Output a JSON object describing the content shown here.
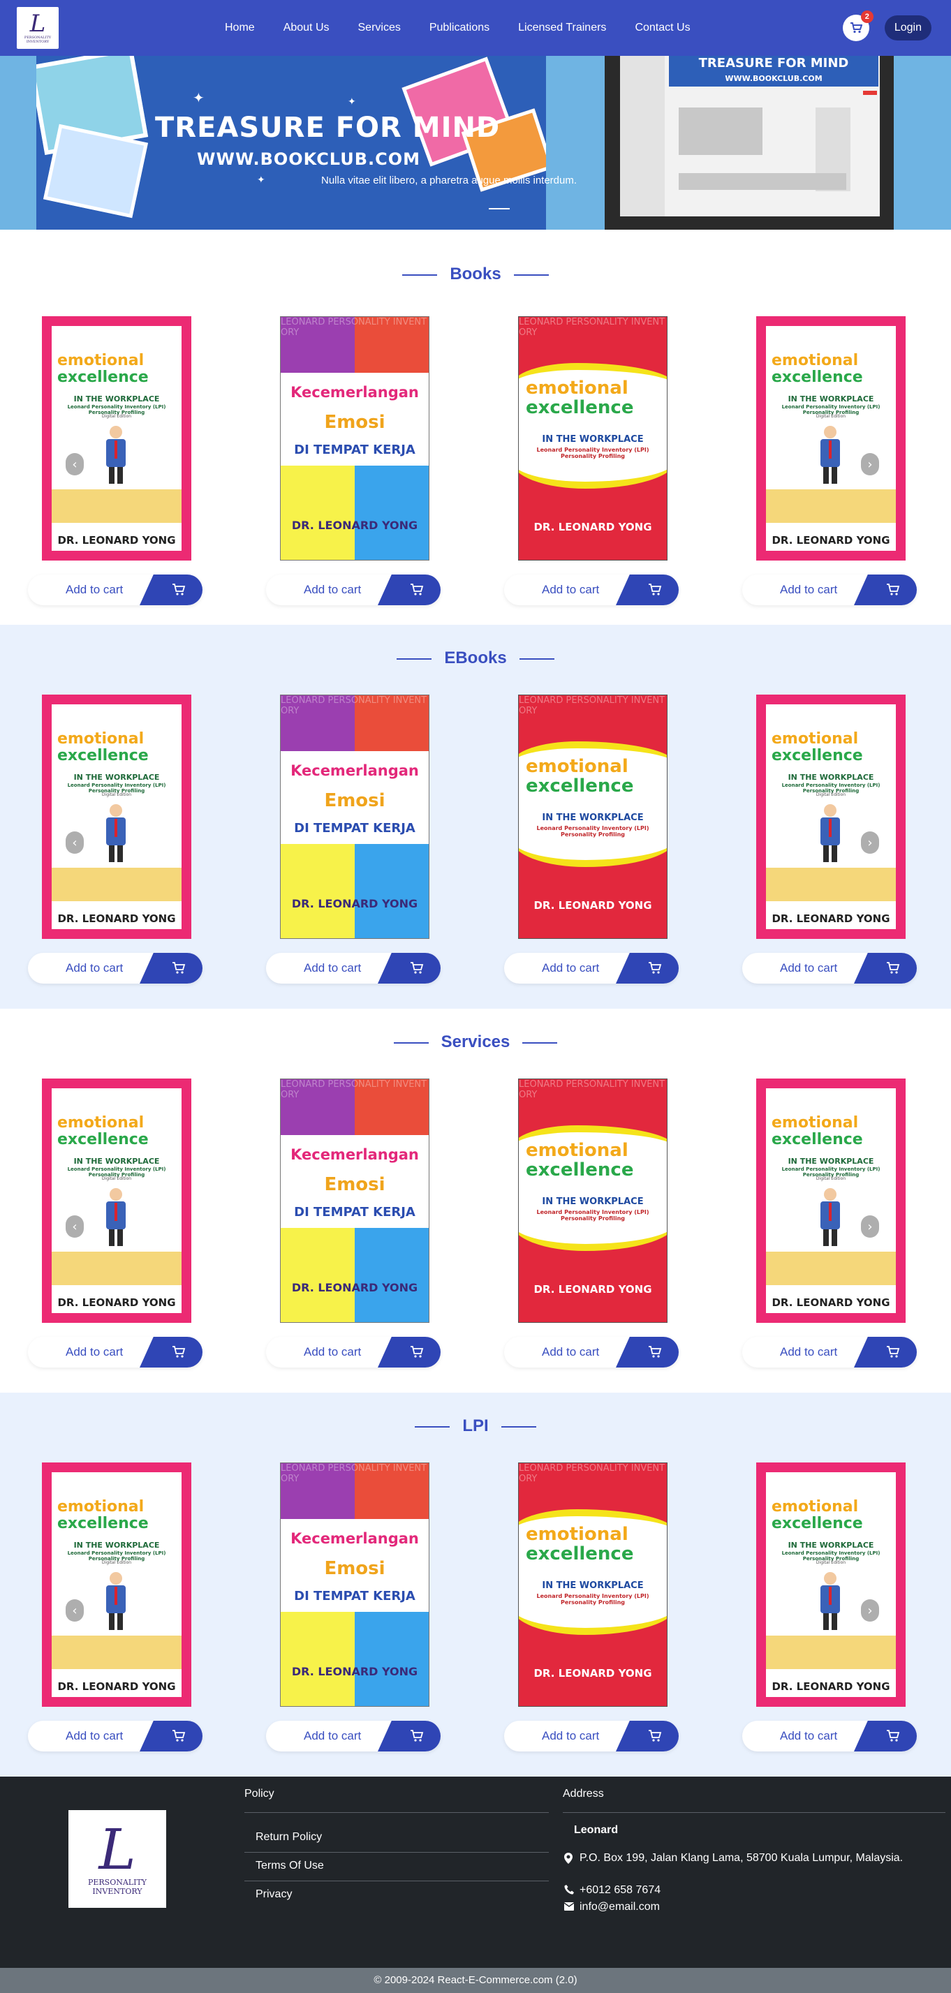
{
  "brand": {
    "logo_letter": "L",
    "logo_caption": "PERSONALITY INVENTORY",
    "accent": "#3a4fc0"
  },
  "nav": {
    "links": [
      "Home",
      "About Us",
      "Services",
      "Publications",
      "Licensed Trainers",
      "Contact Us"
    ],
    "cart_count": "2",
    "login_label": "Login"
  },
  "hero": {
    "title": "TREASURE FOR MIND",
    "subtitle": "WWW.BOOKCLUB.COM",
    "caption": "Nulla vitae elit libero, a pharetra augue mollis interdum."
  },
  "sections": [
    {
      "title": "Books"
    },
    {
      "title": "EBooks"
    },
    {
      "title": "Services"
    },
    {
      "title": "LPI"
    }
  ],
  "card": {
    "add_to_cart_label": "Add to cart"
  },
  "covers": {
    "ee": {
      "line1": "emotional",
      "line2": "excellence",
      "subtitle": "IN THE WORKPLACE",
      "tagline": "Leonard Personality Inventory (LPI) Personality Profiling",
      "edition": "Digital Edition",
      "author": "DR. LEONARD YONG"
    },
    "km": {
      "watermark": "LEONARD PERSONALITY INVENTORY",
      "line1": "Kecemerlangan",
      "line2": "Emosi",
      "line3": "DI TEMPAT KERJA",
      "author": "DR. LEONARD YONG"
    },
    "er": {
      "watermark": "LEONARD PERSONALITY INVENTORY",
      "line1": "emotional",
      "line2": "excellence",
      "subtitle": "IN THE WORKPLACE",
      "tagline": "Leonard Personality Inventory (LPI) Personality Profiling",
      "author": "DR. LEONARD YONG"
    }
  },
  "footer": {
    "policy_heading": "Policy",
    "policy_links": [
      "Return Policy",
      "Terms Of Use",
      "Privacy"
    ],
    "address_heading": "Address",
    "company": "Leonard",
    "address": "P.O. Box 199, Jalan Klang Lama, 58700 Kuala Lumpur, Malaysia.",
    "phone": "+6012 658 7674",
    "email": "info@email.com",
    "logo_caption": "PERSONALITY INVENTORY"
  },
  "copyright": "© 2009-2024 React-E-Commerce.com (2.0)"
}
